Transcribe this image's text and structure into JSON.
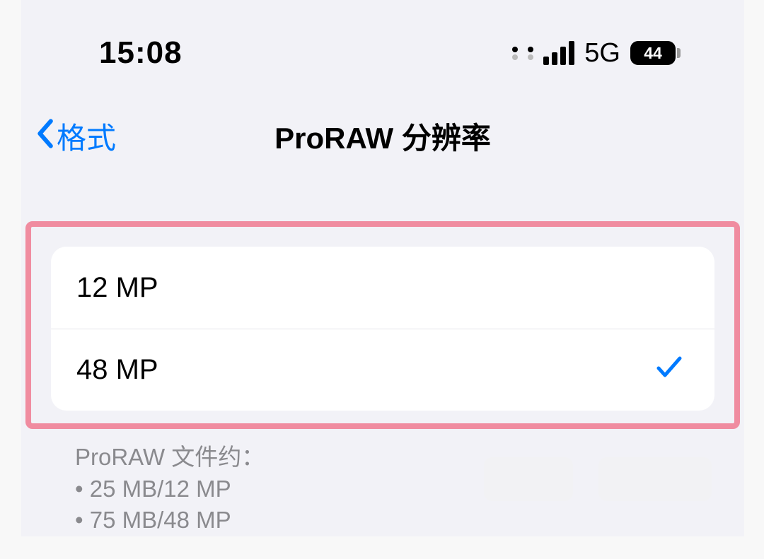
{
  "status": {
    "time": "15:08",
    "network": "5G",
    "battery": "44"
  },
  "nav": {
    "back_label": "格式",
    "title": "ProRAW 分辨率"
  },
  "options": [
    {
      "label": "12 MP",
      "selected": false
    },
    {
      "label": "48 MP",
      "selected": true
    }
  ],
  "footer": {
    "header": "ProRAW 文件约：",
    "lines": [
      "25 MB/12 MP",
      "75 MB/48 MP"
    ]
  }
}
